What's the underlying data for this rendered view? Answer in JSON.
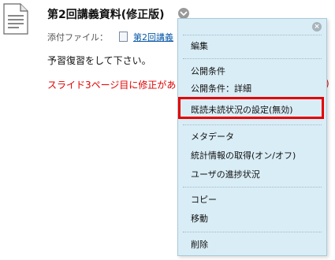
{
  "item": {
    "title": "第2回講義資料(修正版)",
    "attachment_label": "添付ファイル：",
    "attachment_file": "第2回講義",
    "body_text": "予習復習をして下さい。",
    "notice": "スライド3ページ目に修正があ",
    "notice_tail": ")"
  },
  "menu": {
    "close_glyph": "×",
    "items": [
      "編集",
      "公開条件",
      "公開条件：詳細",
      "既読未読状況の設定(無効)",
      "メタデータ",
      "統計情報の取得(オン/オフ)",
      "ユーザの進捗状況",
      "コピー",
      "移動",
      "削除"
    ],
    "highlighted_item": "既読未読状況の設定(無効)"
  },
  "colors": {
    "menu_bg": "#d9edf6",
    "highlight_border": "#e60000",
    "notice_text": "#e00000",
    "link": "#0a5aa8"
  }
}
